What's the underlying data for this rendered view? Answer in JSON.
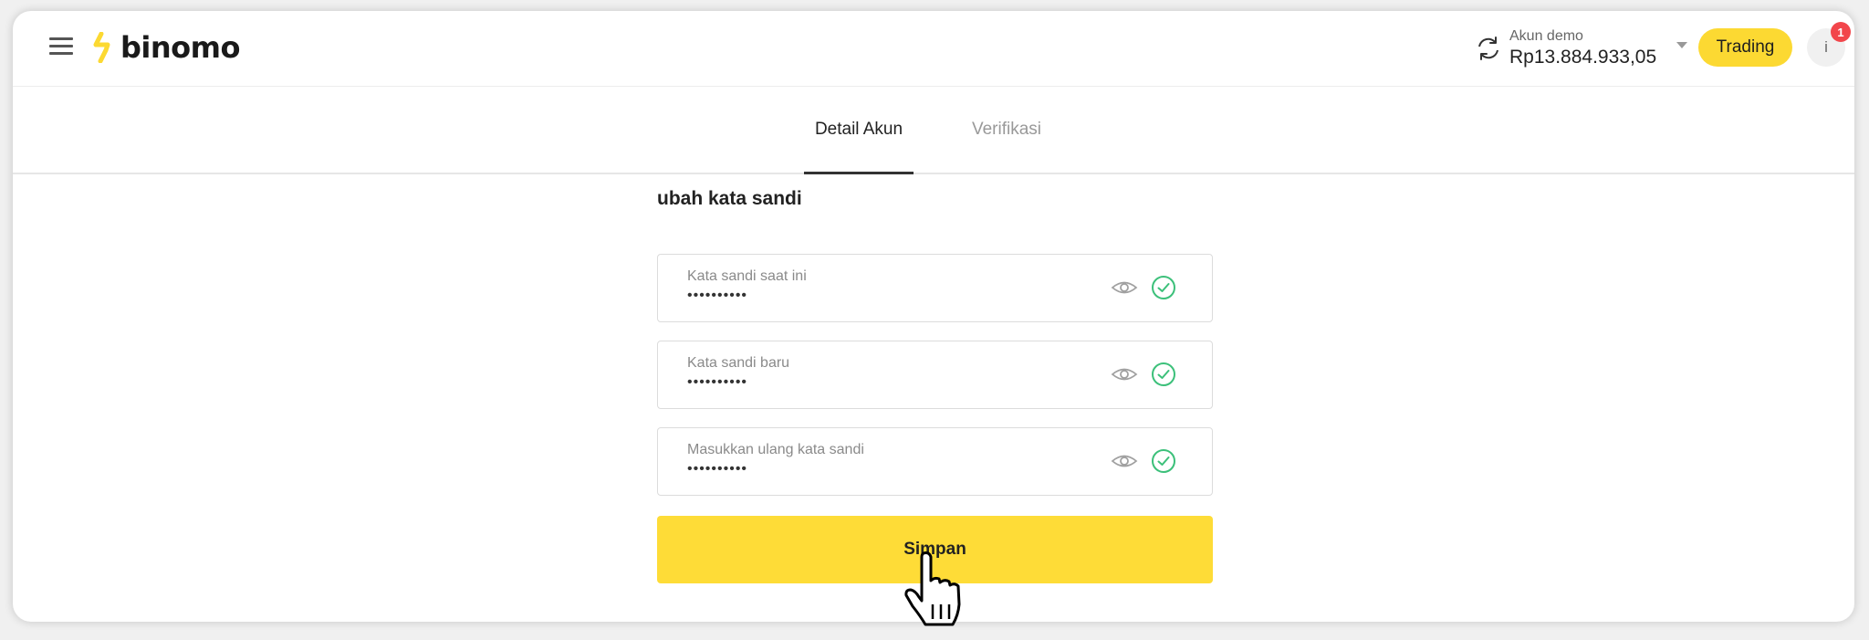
{
  "header": {
    "logo_text": "binomo",
    "account_label": "Akun demo",
    "account_balance": "Rp13.884.933,05",
    "trading_label": "Trading",
    "avatar_initial": "i",
    "notification_count": "1"
  },
  "tabs": [
    {
      "label": "Detail Akun",
      "active": true
    },
    {
      "label": "Verifikasi",
      "active": false
    }
  ],
  "form": {
    "title": "ubah kata sandi",
    "fields": [
      {
        "label": "Kata sandi saat ini",
        "value": "••••••••••"
      },
      {
        "label": "Kata sandi baru",
        "value": "••••••••••"
      },
      {
        "label": "Masukkan ulang kata sandi",
        "value": "••••••••••"
      }
    ],
    "save_label": "Simpan"
  },
  "colors": {
    "accent_yellow": "#fedc37",
    "success_green": "#3cc07a",
    "badge_red": "#f2464b"
  },
  "icons": [
    "menu-icon",
    "binomo-logo-icon",
    "refresh-icon",
    "chevron-down-icon",
    "eye-icon",
    "check-circle-icon",
    "hand-pointer-cursor-icon"
  ]
}
